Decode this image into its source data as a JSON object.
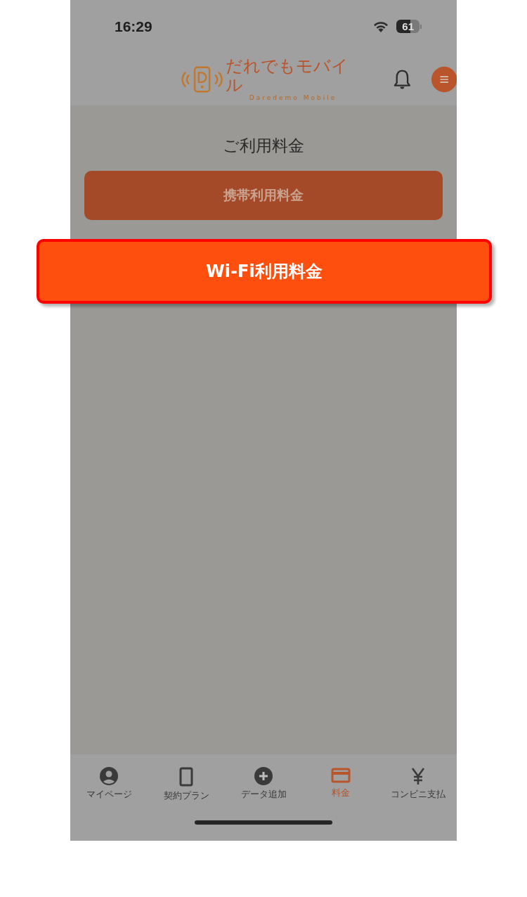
{
  "status_bar": {
    "time": "16:29",
    "battery": "61"
  },
  "header": {
    "logo_text": "だれでもモバイル",
    "logo_subtext": "Daredemo Mobile"
  },
  "page_title": "ご利用料金",
  "buttons": [
    {
      "label": "携帯利用料金",
      "highlighted": false
    },
    {
      "label": "Wi-Fi利用料金",
      "highlighted": true
    }
  ],
  "bottom_nav": [
    {
      "label": "マイページ",
      "selected": false
    },
    {
      "label": "契約プラン",
      "selected": false
    },
    {
      "label": "データ追加",
      "selected": false
    },
    {
      "label": "料金",
      "selected": true
    },
    {
      "label": "コンビニ支払",
      "selected": false
    }
  ]
}
